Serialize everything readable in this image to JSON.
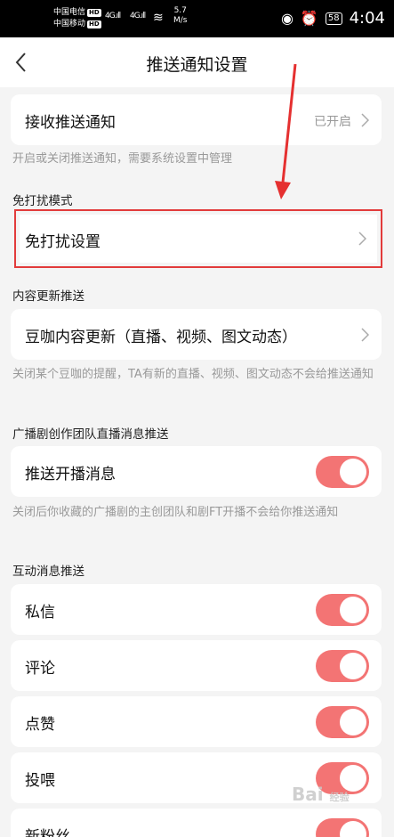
{
  "status_bar": {
    "carrier1": "中国电信",
    "carrier2": "中国移动",
    "hd": "HD",
    "net1": "4G",
    "net2": "4G",
    "speed": "5.7",
    "speed_unit": "M/s",
    "battery": "58",
    "time": "4:04"
  },
  "header": {
    "title": "推送通知设置"
  },
  "receive": {
    "label": "接收推送通知",
    "value": "已开启",
    "hint": "开启或关闭推送通知，需要系统设置中管理"
  },
  "dnd": {
    "section": "免打扰模式",
    "label": "免打扰设置"
  },
  "content": {
    "section": "内容更新推送",
    "label": "豆咖内容更新（直播、视频、图文动态）",
    "hint": "关闭某个豆咖的提醒，TA有新的直播、视频、图文动态不会给推送通知"
  },
  "radio": {
    "section": "广播剧创作团队直播消息推送",
    "label": "推送开播消息",
    "toggle_on": true,
    "hint": "关闭后你收藏的广播剧的主创团队和剧FT开播不会给你推送通知"
  },
  "interact": {
    "section": "互动消息推送",
    "items": [
      {
        "label": "私信",
        "on": true
      },
      {
        "label": "评论",
        "on": true
      },
      {
        "label": "点赞",
        "on": true
      },
      {
        "label": "投喂",
        "on": true
      },
      {
        "label": "新粉丝",
        "on": true
      }
    ]
  },
  "watermark": {
    "text": "Bai",
    "sub": "经验"
  },
  "colors": {
    "toggle": "#f37474",
    "highlight": "#e23b3b"
  }
}
